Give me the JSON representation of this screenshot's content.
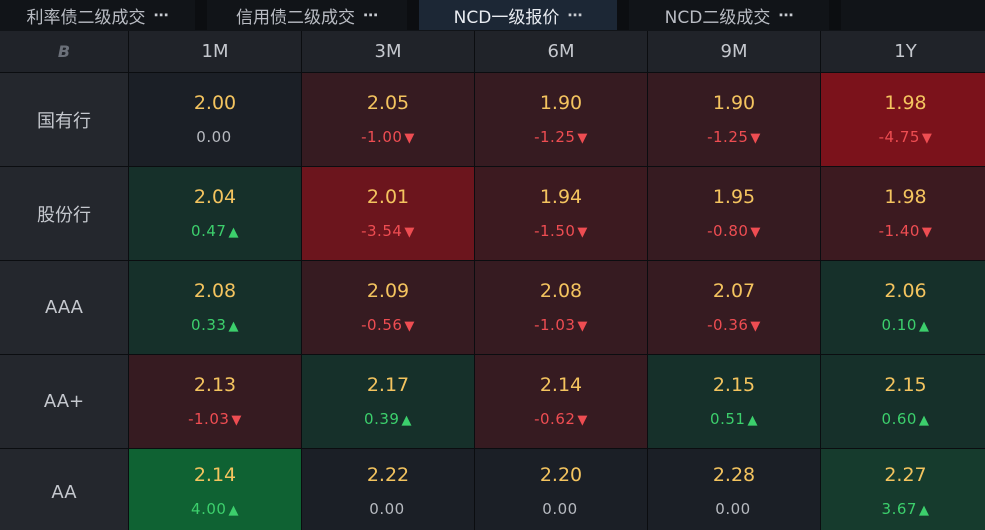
{
  "tabs": [
    {
      "label": "利率债二级成交",
      "more": "⋯",
      "active": false
    },
    {
      "label": "信用债二级成交",
      "more": "⋯",
      "active": false
    },
    {
      "label": "NCD一级报价",
      "more": "⋯",
      "active": true
    },
    {
      "label": "NCD二级成交",
      "more": "⋯",
      "active": false
    }
  ],
  "table": {
    "corner_logo": "B",
    "columns": [
      "1M",
      "3M",
      "6M",
      "9M",
      "1Y"
    ],
    "rows": [
      {
        "label": "国有行",
        "cells": [
          {
            "rate": "2.00",
            "change": "0.00",
            "dir": "flat",
            "arrow": "",
            "shade": "n"
          },
          {
            "rate": "2.05",
            "change": "-1.00",
            "dir": "down",
            "arrow": "▼",
            "shade": "r1"
          },
          {
            "rate": "1.90",
            "change": "-1.25",
            "dir": "down",
            "arrow": "▼",
            "shade": "r1"
          },
          {
            "rate": "1.90",
            "change": "-1.25",
            "dir": "down",
            "arrow": "▼",
            "shade": "r1"
          },
          {
            "rate": "1.98",
            "change": "-4.75",
            "dir": "down",
            "arrow": "▼",
            "shade": "r4"
          }
        ]
      },
      {
        "label": "股份行",
        "cells": [
          {
            "rate": "2.04",
            "change": "0.47",
            "dir": "up",
            "arrow": "▲",
            "shade": "g1"
          },
          {
            "rate": "2.01",
            "change": "-3.54",
            "dir": "down",
            "arrow": "▼",
            "shade": "r3"
          },
          {
            "rate": "1.94",
            "change": "-1.50",
            "dir": "down",
            "arrow": "▼",
            "shade": "r2"
          },
          {
            "rate": "1.95",
            "change": "-0.80",
            "dir": "down",
            "arrow": "▼",
            "shade": "r1"
          },
          {
            "rate": "1.98",
            "change": "-1.40",
            "dir": "down",
            "arrow": "▼",
            "shade": "r2"
          }
        ]
      },
      {
        "label": "AAA",
        "cells": [
          {
            "rate": "2.08",
            "change": "0.33",
            "dir": "up",
            "arrow": "▲",
            "shade": "g1"
          },
          {
            "rate": "2.09",
            "change": "-0.56",
            "dir": "down",
            "arrow": "▼",
            "shade": "r1"
          },
          {
            "rate": "2.08",
            "change": "-1.03",
            "dir": "down",
            "arrow": "▼",
            "shade": "r1"
          },
          {
            "rate": "2.07",
            "change": "-0.36",
            "dir": "down",
            "arrow": "▼",
            "shade": "r1"
          },
          {
            "rate": "2.06",
            "change": "0.10",
            "dir": "up",
            "arrow": "▲",
            "shade": "g1"
          }
        ]
      },
      {
        "label": "AA+",
        "cells": [
          {
            "rate": "2.13",
            "change": "-1.03",
            "dir": "down",
            "arrow": "▼",
            "shade": "r1"
          },
          {
            "rate": "2.17",
            "change": "0.39",
            "dir": "up",
            "arrow": "▲",
            "shade": "g1"
          },
          {
            "rate": "2.14",
            "change": "-0.62",
            "dir": "down",
            "arrow": "▼",
            "shade": "r1"
          },
          {
            "rate": "2.15",
            "change": "0.51",
            "dir": "up",
            "arrow": "▲",
            "shade": "g1"
          },
          {
            "rate": "2.15",
            "change": "0.60",
            "dir": "up",
            "arrow": "▲",
            "shade": "g1"
          }
        ]
      },
      {
        "label": "AA",
        "cells": [
          {
            "rate": "2.14",
            "change": "4.00",
            "dir": "up",
            "arrow": "▲",
            "shade": "g3"
          },
          {
            "rate": "2.22",
            "change": "0.00",
            "dir": "flat",
            "arrow": "",
            "shade": "n"
          },
          {
            "rate": "2.20",
            "change": "0.00",
            "dir": "flat",
            "arrow": "",
            "shade": "n"
          },
          {
            "rate": "2.28",
            "change": "0.00",
            "dir": "flat",
            "arrow": "",
            "shade": "n"
          },
          {
            "rate": "2.27",
            "change": "3.67",
            "dir": "up",
            "arrow": "▲",
            "shade": "g2"
          }
        ]
      }
    ]
  },
  "colors": {
    "rate": "#f4c45f",
    "up": "#3ccf6c",
    "down": "#ee4d52",
    "flat": "#b7bac0"
  }
}
